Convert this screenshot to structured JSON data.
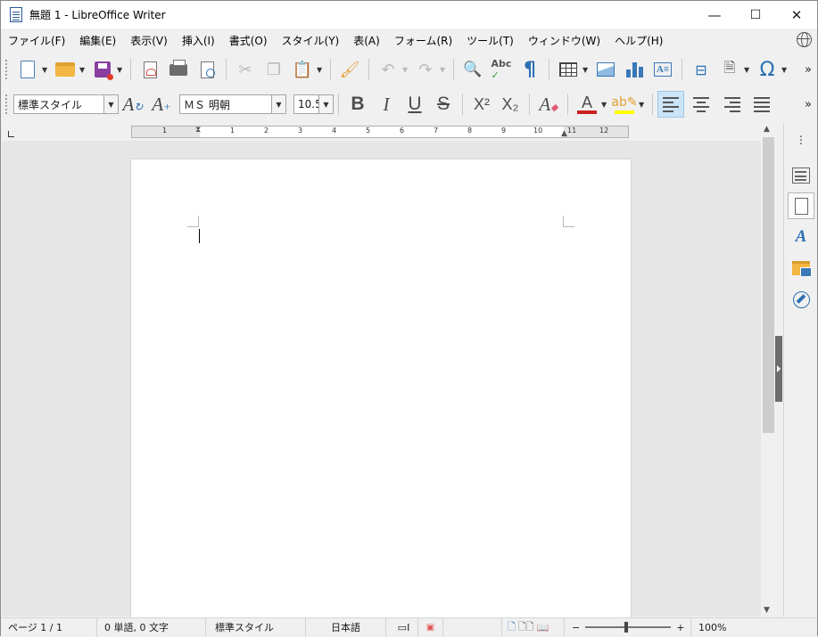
{
  "window": {
    "title": "無題 1 - LibreOffice Writer",
    "minimize": "—",
    "maximize": "☐",
    "close": "✕"
  },
  "menu": [
    "ファイル(F)",
    "編集(E)",
    "表示(V)",
    "挿入(I)",
    "書式(O)",
    "スタイル(Y)",
    "表(A)",
    "フォーム(R)",
    "ツール(T)",
    "ウィンドウ(W)",
    "ヘルプ(H)"
  ],
  "formatting": {
    "paragraph_style": "標準スタイル",
    "font_name": "ＭＳ 明朝",
    "font_size": "10.5",
    "bold": "B",
    "italic": "I",
    "underline": "U",
    "strike": "S",
    "superscript": "X²",
    "subscript": "X₂",
    "font_color": "#c9211e",
    "highlight_color": "#ffff00"
  },
  "ruler": {
    "numbers": [
      "1",
      "1",
      "1",
      "2",
      "3",
      "4",
      "5",
      "6",
      "7",
      "8",
      "9",
      "10",
      "11",
      "12"
    ]
  },
  "status": {
    "page": "ページ 1 / 1",
    "words": "0 単語, 0 文字",
    "page_style": "標準スタイル",
    "language": "日本語",
    "zoom_minus": "−",
    "zoom_plus": "+",
    "zoom": "100%"
  }
}
